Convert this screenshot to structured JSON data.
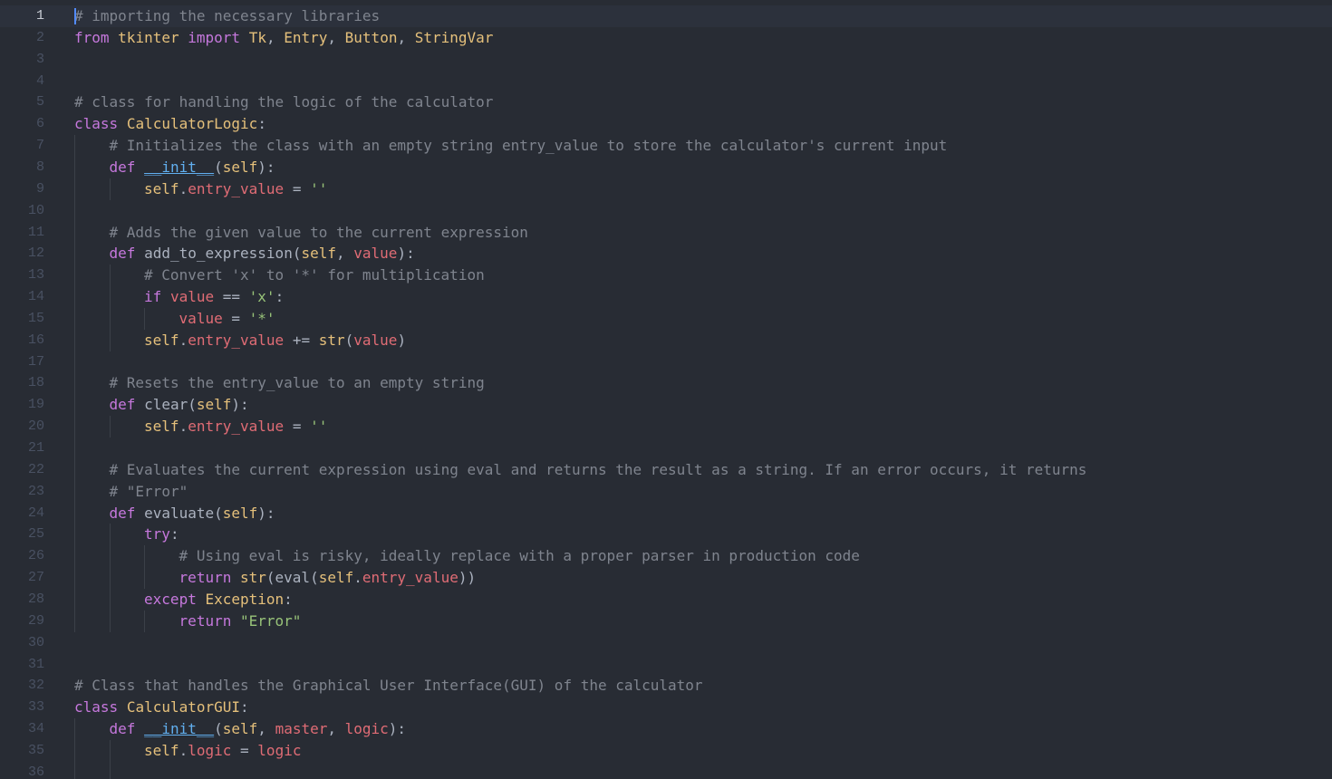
{
  "colors": {
    "background": "#282c34",
    "active_line": "#2c313c",
    "comment": "#7f848e",
    "keyword": "#c678dd",
    "class_name": "#e5c07b",
    "string": "#98c379",
    "function": "#61afef",
    "param": "#e06c75",
    "operator": "#56b6c2",
    "text": "#abb2bf",
    "line_number": "#495162"
  },
  "editor": {
    "language": "python",
    "cursor_line": 1,
    "lines": [
      {
        "n": "1",
        "indent": 0,
        "tokens": [
          {
            "t": "# importing the necessary libraries",
            "k": "comment"
          }
        ]
      },
      {
        "n": "2",
        "indent": 0,
        "tokens": [
          {
            "t": "from",
            "k": "keyword"
          },
          {
            "t": " ",
            "k": "text"
          },
          {
            "t": "tkinter",
            "k": "module"
          },
          {
            "t": " ",
            "k": "text"
          },
          {
            "t": "import",
            "k": "keyword"
          },
          {
            "t": " ",
            "k": "text"
          },
          {
            "t": "Tk",
            "k": "class"
          },
          {
            "t": ", ",
            "k": "text"
          },
          {
            "t": "Entry",
            "k": "class"
          },
          {
            "t": ", ",
            "k": "text"
          },
          {
            "t": "Button",
            "k": "class"
          },
          {
            "t": ", ",
            "k": "text"
          },
          {
            "t": "StringVar",
            "k": "class"
          }
        ]
      },
      {
        "n": "3",
        "indent": 0,
        "tokens": []
      },
      {
        "n": "4",
        "indent": 0,
        "tokens": []
      },
      {
        "n": "5",
        "indent": 0,
        "tokens": [
          {
            "t": "# class for handling the logic of the calculator",
            "k": "comment"
          }
        ]
      },
      {
        "n": "6",
        "indent": 0,
        "tokens": [
          {
            "t": "class",
            "k": "keyword"
          },
          {
            "t": " ",
            "k": "text"
          },
          {
            "t": "CalculatorLogic",
            "k": "class"
          },
          {
            "t": ":",
            "k": "text"
          }
        ]
      },
      {
        "n": "7",
        "indent": 1,
        "tokens": [
          {
            "t": "# Initializes the class with an empty string entry_value to store the calculator's current input",
            "k": "comment"
          }
        ]
      },
      {
        "n": "8",
        "indent": 1,
        "tokens": [
          {
            "t": "def",
            "k": "keyword"
          },
          {
            "t": " ",
            "k": "text"
          },
          {
            "t": "__init__",
            "k": "dunder"
          },
          {
            "t": "(",
            "k": "text"
          },
          {
            "t": "self",
            "k": "self"
          },
          {
            "t": "):",
            "k": "text"
          }
        ]
      },
      {
        "n": "9",
        "indent": 2,
        "tokens": [
          {
            "t": "self",
            "k": "self"
          },
          {
            "t": ".",
            "k": "text"
          },
          {
            "t": "entry_value",
            "k": "var"
          },
          {
            "t": " ",
            "k": "text"
          },
          {
            "t": "=",
            "k": "operator"
          },
          {
            "t": " ",
            "k": "text"
          },
          {
            "t": "''",
            "k": "string"
          }
        ]
      },
      {
        "n": "10",
        "indent": 0,
        "tokens": []
      },
      {
        "n": "11",
        "indent": 1,
        "tokens": [
          {
            "t": "# Adds the given value to the current expression",
            "k": "comment"
          }
        ]
      },
      {
        "n": "12",
        "indent": 1,
        "tokens": [
          {
            "t": "def",
            "k": "keyword"
          },
          {
            "t": " ",
            "k": "text"
          },
          {
            "t": "add_to_expression",
            "k": "function"
          },
          {
            "t": "(",
            "k": "text"
          },
          {
            "t": "self",
            "k": "self"
          },
          {
            "t": ", ",
            "k": "text"
          },
          {
            "t": "value",
            "k": "param"
          },
          {
            "t": "):",
            "k": "text"
          }
        ]
      },
      {
        "n": "13",
        "indent": 2,
        "tokens": [
          {
            "t": "# Convert 'x' to '*' for multiplication",
            "k": "comment"
          }
        ]
      },
      {
        "n": "14",
        "indent": 2,
        "tokens": [
          {
            "t": "if",
            "k": "keyword"
          },
          {
            "t": " ",
            "k": "text"
          },
          {
            "t": "value",
            "k": "var"
          },
          {
            "t": " ",
            "k": "text"
          },
          {
            "t": "==",
            "k": "operator"
          },
          {
            "t": " ",
            "k": "text"
          },
          {
            "t": "'x'",
            "k": "string"
          },
          {
            "t": ":",
            "k": "text"
          }
        ]
      },
      {
        "n": "15",
        "indent": 3,
        "tokens": [
          {
            "t": "value",
            "k": "var"
          },
          {
            "t": " ",
            "k": "text"
          },
          {
            "t": "=",
            "k": "operator"
          },
          {
            "t": " ",
            "k": "text"
          },
          {
            "t": "'*'",
            "k": "string"
          }
        ]
      },
      {
        "n": "16",
        "indent": 2,
        "tokens": [
          {
            "t": "self",
            "k": "self"
          },
          {
            "t": ".",
            "k": "text"
          },
          {
            "t": "entry_value",
            "k": "var"
          },
          {
            "t": " ",
            "k": "text"
          },
          {
            "t": "+=",
            "k": "operator"
          },
          {
            "t": " ",
            "k": "text"
          },
          {
            "t": "str",
            "k": "builtin"
          },
          {
            "t": "(",
            "k": "text"
          },
          {
            "t": "value",
            "k": "var"
          },
          {
            "t": ")",
            "k": "text"
          }
        ]
      },
      {
        "n": "17",
        "indent": 0,
        "tokens": []
      },
      {
        "n": "18",
        "indent": 1,
        "tokens": [
          {
            "t": "# Resets the entry_value to an empty string",
            "k": "comment"
          }
        ]
      },
      {
        "n": "19",
        "indent": 1,
        "tokens": [
          {
            "t": "def",
            "k": "keyword"
          },
          {
            "t": " ",
            "k": "text"
          },
          {
            "t": "clear",
            "k": "function"
          },
          {
            "t": "(",
            "k": "text"
          },
          {
            "t": "self",
            "k": "self"
          },
          {
            "t": "):",
            "k": "text"
          }
        ]
      },
      {
        "n": "20",
        "indent": 2,
        "tokens": [
          {
            "t": "self",
            "k": "self"
          },
          {
            "t": ".",
            "k": "text"
          },
          {
            "t": "entry_value",
            "k": "var"
          },
          {
            "t": " ",
            "k": "text"
          },
          {
            "t": "=",
            "k": "operator"
          },
          {
            "t": " ",
            "k": "text"
          },
          {
            "t": "''",
            "k": "string"
          }
        ]
      },
      {
        "n": "21",
        "indent": 0,
        "tokens": []
      },
      {
        "n": "22",
        "indent": 1,
        "tokens": [
          {
            "t": "# Evaluates the current expression using eval and returns the result as a string. If an error occurs, it returns",
            "k": "comment"
          }
        ]
      },
      {
        "n": "23",
        "indent": 1,
        "tokens": [
          {
            "t": "# \"Error\"",
            "k": "comment"
          }
        ]
      },
      {
        "n": "24",
        "indent": 1,
        "tokens": [
          {
            "t": "def",
            "k": "keyword"
          },
          {
            "t": " ",
            "k": "text"
          },
          {
            "t": "evaluate",
            "k": "function"
          },
          {
            "t": "(",
            "k": "text"
          },
          {
            "t": "self",
            "k": "self"
          },
          {
            "t": "):",
            "k": "text"
          }
        ]
      },
      {
        "n": "25",
        "indent": 2,
        "tokens": [
          {
            "t": "try",
            "k": "keyword"
          },
          {
            "t": ":",
            "k": "text"
          }
        ]
      },
      {
        "n": "26",
        "indent": 3,
        "tokens": [
          {
            "t": "# Using eval is risky, ideally replace with a proper parser in production code",
            "k": "comment"
          }
        ]
      },
      {
        "n": "27",
        "indent": 3,
        "tokens": [
          {
            "t": "return",
            "k": "keyword"
          },
          {
            "t": " ",
            "k": "text"
          },
          {
            "t": "str",
            "k": "builtin"
          },
          {
            "t": "(",
            "k": "text"
          },
          {
            "t": "eval",
            "k": "function"
          },
          {
            "t": "(",
            "k": "text"
          },
          {
            "t": "self",
            "k": "self"
          },
          {
            "t": ".",
            "k": "text"
          },
          {
            "t": "entry_value",
            "k": "var"
          },
          {
            "t": "))",
            "k": "text"
          }
        ]
      },
      {
        "n": "28",
        "indent": 2,
        "tokens": [
          {
            "t": "except",
            "k": "keyword"
          },
          {
            "t": " ",
            "k": "text"
          },
          {
            "t": "Exception",
            "k": "class"
          },
          {
            "t": ":",
            "k": "text"
          }
        ]
      },
      {
        "n": "29",
        "indent": 3,
        "tokens": [
          {
            "t": "return",
            "k": "keyword"
          },
          {
            "t": " ",
            "k": "text"
          },
          {
            "t": "\"Error\"",
            "k": "string"
          }
        ]
      },
      {
        "n": "30",
        "indent": 0,
        "tokens": []
      },
      {
        "n": "31",
        "indent": 0,
        "tokens": []
      },
      {
        "n": "32",
        "indent": 0,
        "tokens": [
          {
            "t": "# Class that handles the Graphical User Interface(GUI) of the calculator",
            "k": "comment"
          }
        ]
      },
      {
        "n": "33",
        "indent": 0,
        "tokens": [
          {
            "t": "class",
            "k": "keyword"
          },
          {
            "t": " ",
            "k": "text"
          },
          {
            "t": "CalculatorGUI",
            "k": "class"
          },
          {
            "t": ":",
            "k": "text"
          }
        ]
      },
      {
        "n": "34",
        "indent": 1,
        "tokens": [
          {
            "t": "def",
            "k": "keyword"
          },
          {
            "t": " ",
            "k": "text"
          },
          {
            "t": "__init__",
            "k": "dunder"
          },
          {
            "t": "(",
            "k": "text"
          },
          {
            "t": "self",
            "k": "self"
          },
          {
            "t": ", ",
            "k": "text"
          },
          {
            "t": "master",
            "k": "param"
          },
          {
            "t": ", ",
            "k": "text"
          },
          {
            "t": "logic",
            "k": "param"
          },
          {
            "t": "):",
            "k": "text"
          }
        ]
      },
      {
        "n": "35",
        "indent": 2,
        "tokens": [
          {
            "t": "self",
            "k": "self"
          },
          {
            "t": ".",
            "k": "text"
          },
          {
            "t": "logic",
            "k": "var"
          },
          {
            "t": " ",
            "k": "text"
          },
          {
            "t": "=",
            "k": "operator"
          },
          {
            "t": " ",
            "k": "text"
          },
          {
            "t": "logic",
            "k": "var"
          }
        ]
      },
      {
        "n": "36",
        "indent": 2,
        "tokens": []
      }
    ]
  }
}
